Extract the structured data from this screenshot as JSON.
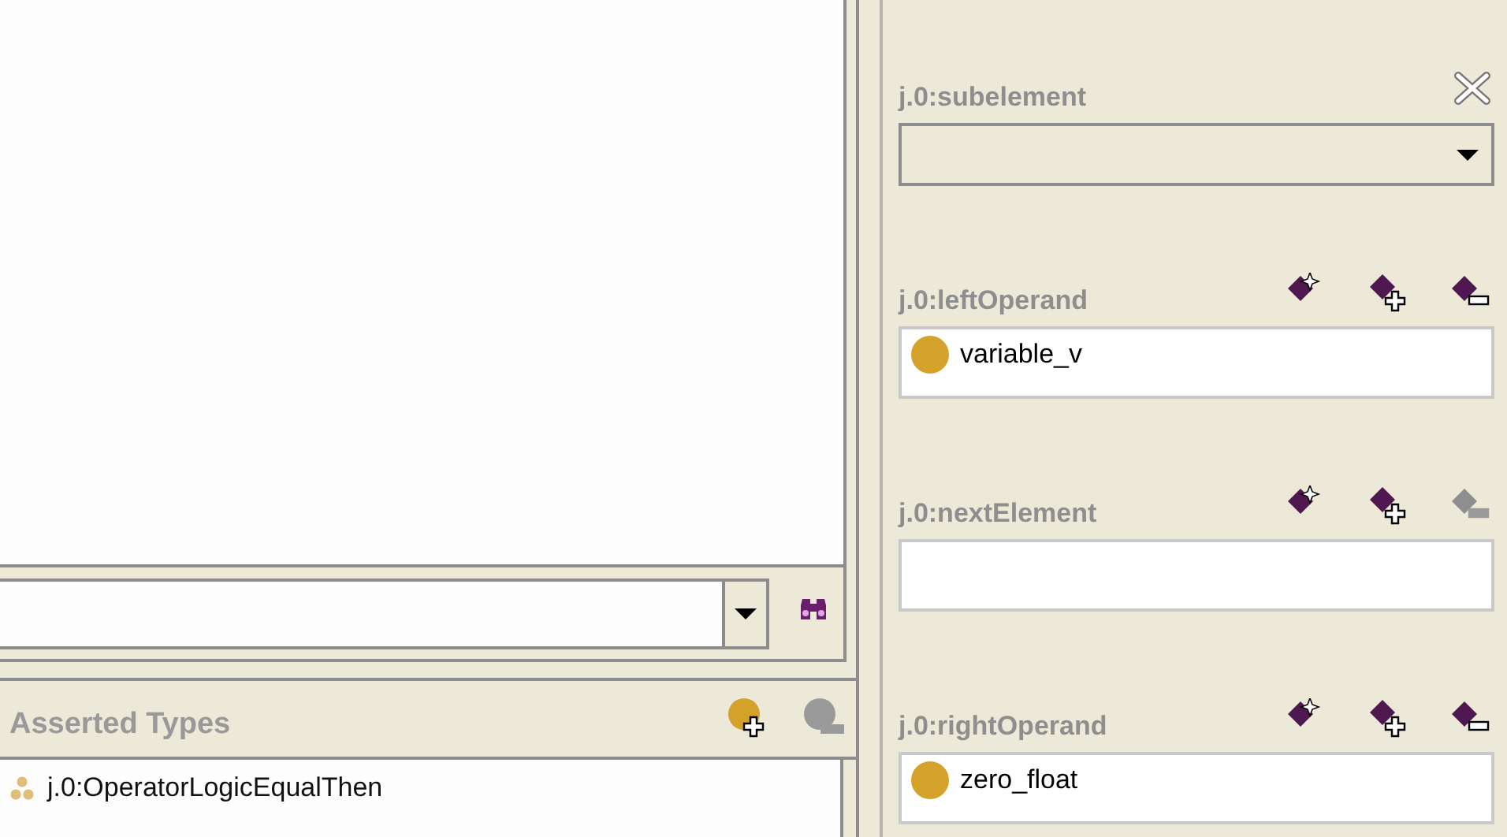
{
  "asserted_types": {
    "title": "Asserted Types",
    "add_disabled": false,
    "remove_disabled": true,
    "items": [
      {
        "label": "j.0:OperatorLogicEqualThen"
      }
    ]
  },
  "properties": [
    {
      "kind": "combo",
      "label": "j.0:subelement",
      "closable": true
    },
    {
      "kind": "instance",
      "label": "j.0:leftOperand",
      "remove_disabled": false,
      "values": [
        "variable_v"
      ]
    },
    {
      "kind": "instance",
      "label": "j.0:nextElement",
      "remove_disabled": true
    },
    {
      "kind": "instance",
      "label": "j.0:rightOperand",
      "remove_disabled": false,
      "values": [
        "zero_float"
      ]
    }
  ]
}
